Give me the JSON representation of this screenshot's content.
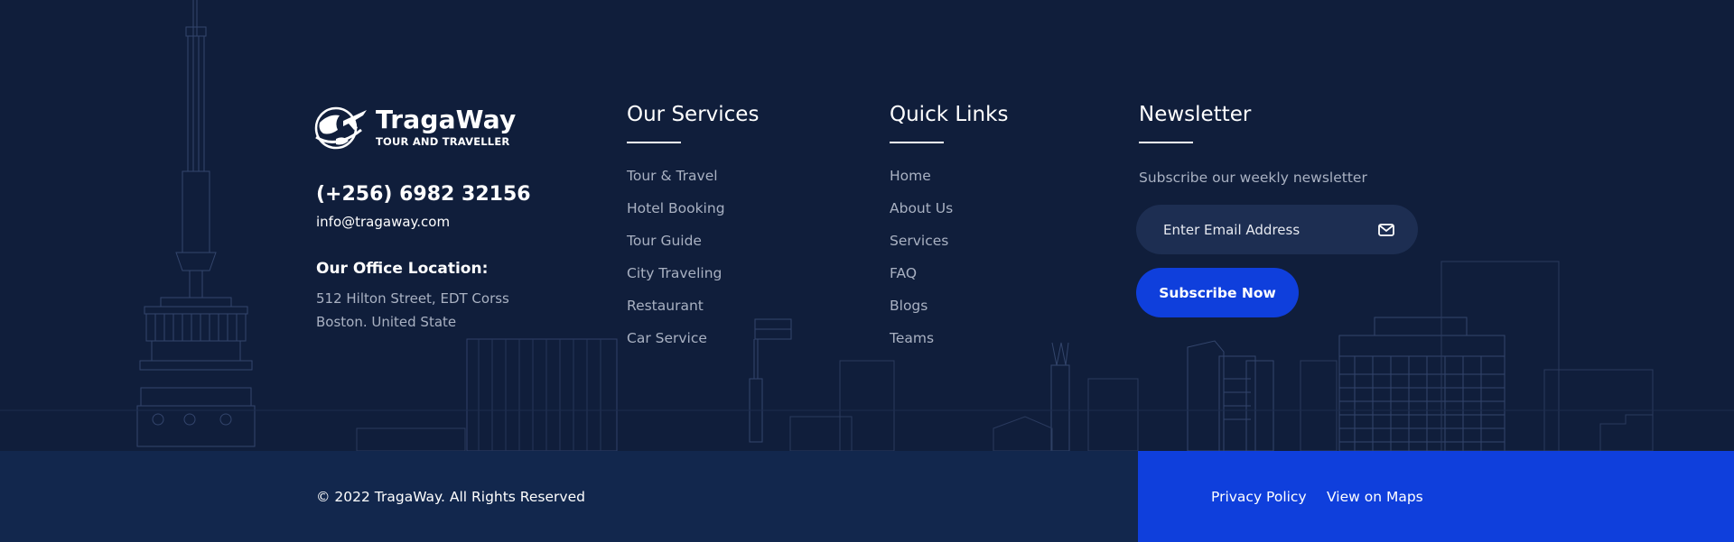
{
  "brand": {
    "name": "TragaWay",
    "tagline": "TOUR AND TRAVELLER"
  },
  "contact": {
    "phone": "(+256) 6982 32156",
    "email": "info@tragaway.com",
    "office_title": "Our Office Location:",
    "address_line1": "512 Hilton Street, EDT Corss",
    "address_line2": "Boston. United State"
  },
  "services": {
    "title": "Our Services",
    "links": [
      "Tour & Travel",
      "Hotel Booking",
      "Tour Guide",
      "City Traveling",
      "Restaurant",
      "Car Service"
    ]
  },
  "quick_links": {
    "title": "Quick Links",
    "links": [
      "Home",
      "About Us",
      "Services",
      "FAQ",
      "Blogs",
      "Teams"
    ]
  },
  "newsletter": {
    "title": "Newsletter",
    "subtitle": "Subscribe our weekly newsletter",
    "email_placeholder": "Enter Email Address",
    "subscribe_label": "Subscribe Now",
    "icon": "mail-icon"
  },
  "bottom": {
    "copyright": "© 2022 TragaWay. All Rights Reserved",
    "privacy_label": "Privacy Policy",
    "maps_label": "View on Maps"
  },
  "colors": {
    "background": "#101e3b",
    "bottom_bar": "#12274d",
    "accent": "#0f3fdc",
    "muted_text": "#a9b1c2"
  }
}
